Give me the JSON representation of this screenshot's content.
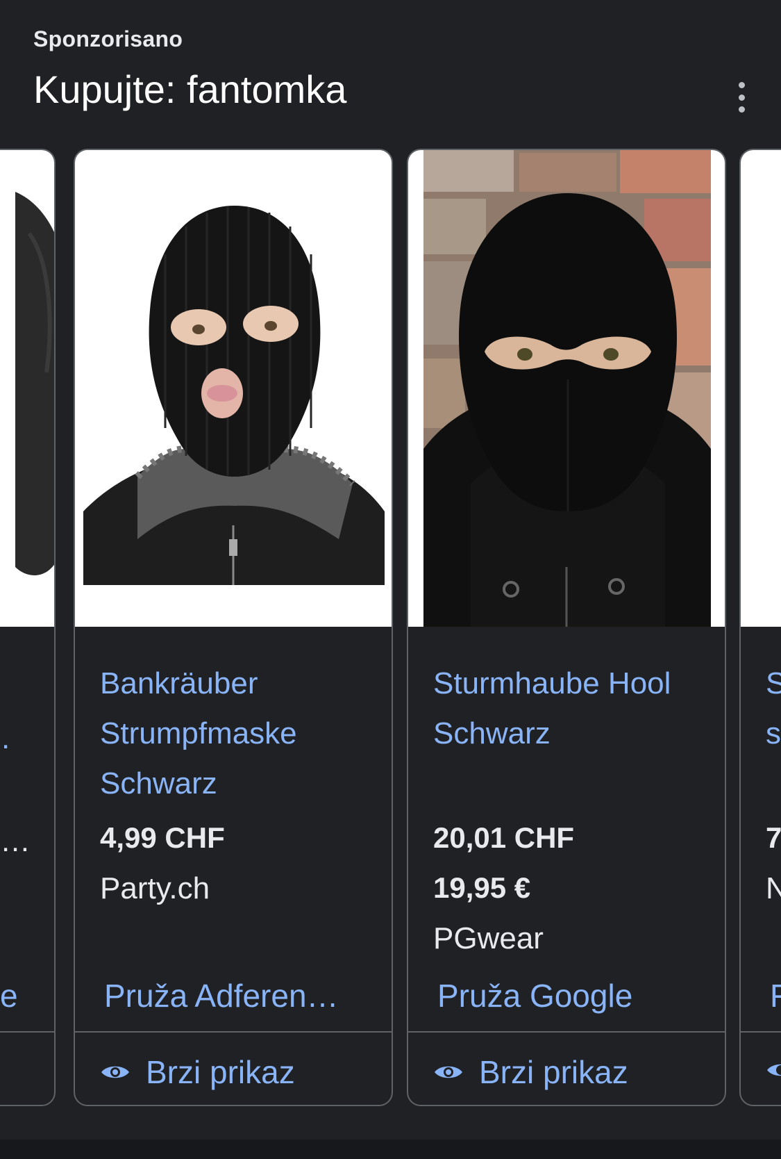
{
  "header": {
    "sponsored_label": "Sponzorisano",
    "title": "Kupujte: fantomka",
    "more_icon": "more-vert-icon"
  },
  "cards": [
    {
      "title": "Bankräuber Strumpfmaske Schwarz",
      "prices": [
        "4,99 CHF"
      ],
      "merchant": "Party.ch",
      "provider": "Pruža Adferen…",
      "quickview_label": "Brzi prikaz",
      "image_icon": "knit-balaclava-image"
    },
    {
      "title": "Sturmhaube Hool Schwarz",
      "prices": [
        "20,01 CHF",
        "19,95 €"
      ],
      "merchant": "PGwear",
      "provider": "Pruža Google",
      "quickview_label": "Brzi prikaz",
      "image_icon": "balaclava-image"
    }
  ],
  "partial_left_card": {
    "provider_tail": "e",
    "merchant_tail": "…",
    "title_tail": "."
  },
  "partial_right_card": {
    "title_lines": [
      "S",
      "s"
    ],
    "price_head": "7",
    "merchant_head": "N",
    "provider_head": "F"
  },
  "colors": {
    "background": "#202124",
    "link": "#8ab4f8",
    "text": "#e8eaed",
    "border": "#5f6368"
  }
}
